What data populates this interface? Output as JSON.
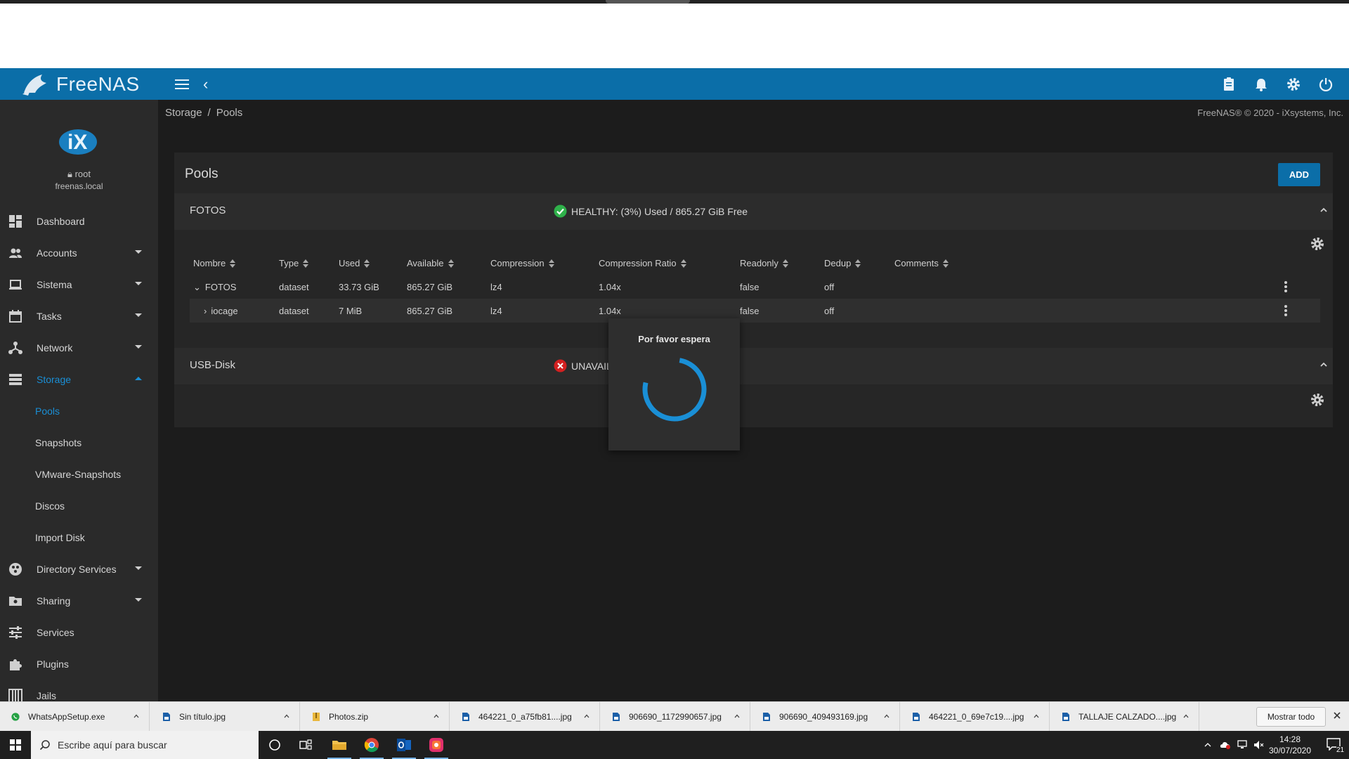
{
  "app": {
    "brand": "FreeNAS",
    "copyright": "FreeNAS® © 2020 - iXsystems, Inc.",
    "accent_color": "#0b6ea8",
    "active_color": "#1a8fd6"
  },
  "topbar": {
    "icons": [
      "hamburger-icon",
      "back-chevron-icon",
      "clipboard-icon",
      "bell-icon",
      "gear-icon",
      "power-icon"
    ]
  },
  "user": {
    "name": "root",
    "host": "freenas.local"
  },
  "sidebar": {
    "items": [
      {
        "label": "Dashboard",
        "icon": "dashboard-icon",
        "has_caret": false
      },
      {
        "label": "Accounts",
        "icon": "accounts-icon",
        "has_caret": true
      },
      {
        "label": "Sistema",
        "icon": "laptop-icon",
        "has_caret": true
      },
      {
        "label": "Tasks",
        "icon": "calendar-icon",
        "has_caret": true
      },
      {
        "label": "Network",
        "icon": "network-icon",
        "has_caret": true
      },
      {
        "label": "Storage",
        "icon": "storage-icon",
        "has_caret": true,
        "active": true
      },
      {
        "label": "Directory Services",
        "icon": "directory-icon",
        "has_caret": true
      },
      {
        "label": "Sharing",
        "icon": "sharing-icon",
        "has_caret": true
      },
      {
        "label": "Services",
        "icon": "sliders-icon",
        "has_caret": false
      },
      {
        "label": "Plugins",
        "icon": "puzzle-icon",
        "has_caret": false
      },
      {
        "label": "Jails",
        "icon": "jail-icon",
        "has_caret": false
      }
    ],
    "storage_sub": [
      "Pools",
      "Snapshots",
      "VMware-Snapshots",
      "Discos",
      "Import Disk"
    ]
  },
  "breadcrumb": {
    "parent": "Storage",
    "separator": "/",
    "current": "Pools"
  },
  "pools": {
    "title": "Pools",
    "add_label": "ADD",
    "columns": [
      "Nombre",
      "Type",
      "Used",
      "Available",
      "Compression",
      "Compression Ratio",
      "Readonly",
      "Dedup",
      "Comments"
    ],
    "fotos": {
      "name": "FOTOS",
      "status": "HEALTHY: (3%) Used / 865.27 GiB Free",
      "status_color": "#2fb14a",
      "rows": [
        {
          "name": "FOTOS",
          "type": "dataset",
          "used": "33.73 GiB",
          "available": "865.27 GiB",
          "compression": "lz4",
          "ratio": "1.04x",
          "readonly": "false",
          "dedup": "off",
          "comments": ""
        },
        {
          "name": "iocage",
          "type": "dataset",
          "used": "7 MiB",
          "available": "865.27 GiB",
          "compression": "lz4",
          "ratio": "1.04x",
          "readonly": "false",
          "dedup": "off",
          "comments": ""
        }
      ]
    },
    "usb": {
      "name": "USB-Disk",
      "status": "UNAVAIL",
      "status_color": "#d32020"
    }
  },
  "modal": {
    "title": "Por favor espera"
  },
  "downloads": {
    "items": [
      "WhatsAppSetup.exe",
      "Sin título.jpg",
      "Photos.zip",
      "464221_0_a75fb81....jpg",
      "906690_1172990657.jpg",
      "906690_409493169.jpg",
      "464221_0_69e7c19....jpg",
      "TALLAJE CALZADO....jpg"
    ],
    "show_all_label": "Mostrar todo"
  },
  "taskbar": {
    "search_placeholder": "Escribe aquí para buscar",
    "time": "14:28",
    "date": "30/07/2020",
    "notification_count": "21"
  }
}
